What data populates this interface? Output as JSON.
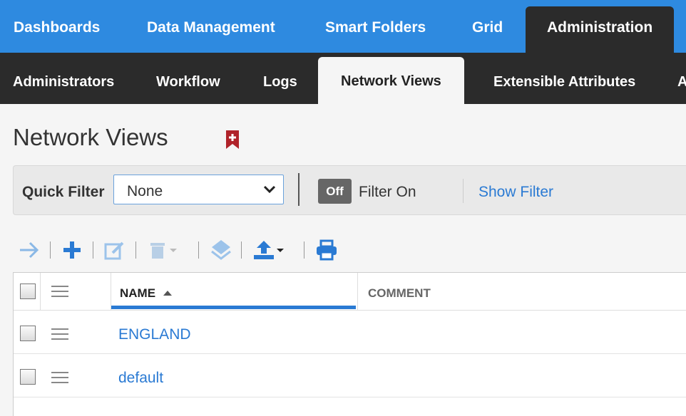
{
  "topnav": {
    "items": [
      {
        "label": "Dashboards"
      },
      {
        "label": "Data Management"
      },
      {
        "label": "Smart Folders"
      },
      {
        "label": "Grid"
      },
      {
        "label": "Administration"
      }
    ]
  },
  "subnav": {
    "items": [
      {
        "label": "Administrators"
      },
      {
        "label": "Workflow"
      },
      {
        "label": "Logs"
      },
      {
        "label": "Network Views"
      },
      {
        "label": "Extensible Attributes"
      },
      {
        "label": "A"
      }
    ]
  },
  "page": {
    "title": "Network Views"
  },
  "filter": {
    "quick_filter_label": "Quick Filter",
    "quick_filter_value": "None",
    "toggle_label": "Off",
    "filter_on_label": "Filter On",
    "show_filter_label": "Show Filter"
  },
  "toolbar": {
    "icons": [
      "arrow-right-icon",
      "plus-icon",
      "edit-icon",
      "trash-icon",
      "layers-icon",
      "upload-icon",
      "print-icon"
    ]
  },
  "table": {
    "columns": [
      {
        "label": "NAME",
        "sorted": "ascending"
      },
      {
        "label": "COMMENT"
      }
    ],
    "rows": [
      {
        "name": "ENGLAND",
        "comment": ""
      },
      {
        "name": "default",
        "comment": ""
      }
    ]
  },
  "colors": {
    "topnav_bg": "#2e8ae0",
    "subnav_bg": "#2b2b2b",
    "link": "#2a7ad3",
    "bookmark": "#b0232a"
  }
}
